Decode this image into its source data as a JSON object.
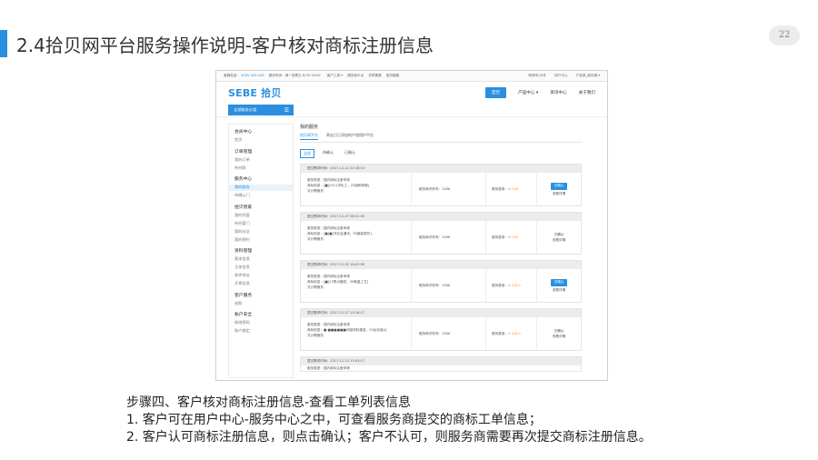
{
  "slide": {
    "title": "2.4拾贝网平台服务操作说明-客户核对商标注册信息",
    "page_number": "22",
    "accent_color": "#2a8fe0"
  },
  "site": {
    "topbar": {
      "left_prefix": "客服电话：",
      "phone": "4000-420-426",
      "hours": "服务时间：周一到周五 8:30-18:00",
      "links": [
        "客户工具 ▾",
        "服务商平台",
        "供求需要",
        "股份圈圈"
      ],
      "right": [
        "购物车(0)件",
        "用户中心",
        "产品类_碳存储 ▾"
      ]
    },
    "logo": "SEBE 拾贝",
    "nav": {
      "home": "首页",
      "items": [
        "产品中心 ▾",
        "资讯中心",
        "关于我们"
      ]
    },
    "category_button": "全部服务分类",
    "sidebar": [
      {
        "head": "会员中心",
        "items": [
          "首页"
        ]
      },
      {
        "head": "订单管理",
        "items": [
          "我的订单",
          "待付款"
        ]
      },
      {
        "head": "服务中心",
        "items": [
          "我的服务",
          "待确认门"
        ],
        "active": 0
      },
      {
        "head": "拾贝管家",
        "items": [
          "我的托管",
          "待托管门",
          "我的存证",
          "我的预约"
        ]
      },
      {
        "head": "资料管理",
        "items": [
          "基本信息",
          "主体信息",
          "收件地址",
          "开票信息"
        ]
      },
      {
        "head": "客户服务",
        "items": [
          "退款"
        ]
      },
      {
        "head": "账户安全",
        "items": [
          "修改密码",
          "账户绑定"
        ]
      }
    ],
    "main": {
      "title": "我的服务",
      "tabs": [
        "拾贝网平台",
        "两支已已添加的产权保护平台"
      ],
      "filters": [
        "全部",
        "待确认",
        "已确认"
      ],
      "orders": [
        {
          "time": "提交需求时间：2017-12-12 20:18:13",
          "type": "服务类型：国内商标注册申请",
          "info": "商标信息：[■]2011洋化工，23组和晾晒]",
          "more": "共计需服务",
          "code_label": "服务单识别号：1006",
          "fee": "服务费用：",
          "fee_value": "¥ 0.00",
          "confirm": "去确认",
          "status": "",
          "detail": "查看详情"
        },
        {
          "time": "提交需求时间：2017-12-07 08:31:05",
          "type": "服务类型：国内商标注册申请",
          "info": "商标信息：[■]■[洋互会通讯，PA服装零件]",
          "more": "共计需服务",
          "code_label": "服务单识别号：1006",
          "fee": "服务费用：",
          "fee_value": "¥ 0.00",
          "confirm": "",
          "status": "已确认",
          "detail": "查看详情"
        },
        {
          "time": "提交需求时间：2017-11-22 16:02:50",
          "type": "服务类型：国内商标注册申请",
          "info": "商标信息：[■]13枣大棚成，39紫晶工艺]",
          "more": "共计需服务",
          "code_label": "服务单识别号：1006",
          "fee": "服务费用：",
          "fee_value": "¥ 100.0",
          "confirm": "去确认",
          "status": "",
          "detail": "查看详情"
        },
        {
          "time": "提交需求时间：2017-11-17 14:16:27",
          "type": "服务类型：国内商标注册申请",
          "info": "商标信息：■ ■■■■■■词组材料建造，23台泡泡A]",
          "more": "共计需服务",
          "code_label": "服务单识别号：1006",
          "fee": "服务费用：",
          "fee_value": "¥ 100.0",
          "confirm": "",
          "status": "已确认",
          "detail": "查看详情"
        },
        {
          "time": "提交需求时间：2017-11-13 13:03:17",
          "type": "服务类型：国内商标注册申请",
          "info": "",
          "more": "",
          "code_label": "",
          "fee": "",
          "fee_value": "",
          "confirm": "",
          "status": "",
          "detail": ""
        }
      ]
    }
  },
  "caption": {
    "heading": "步骤四、客户核对商标注册信息-查看工单列表信息",
    "line1": "1.   客户可在用户中心-服务中心之中，可查看服务商提交的商标工单信息；",
    "line2": "2.   客户认可商标注册信息，则点击确认；客户不认可，则服务商需要再次提交商标注册信息。"
  }
}
